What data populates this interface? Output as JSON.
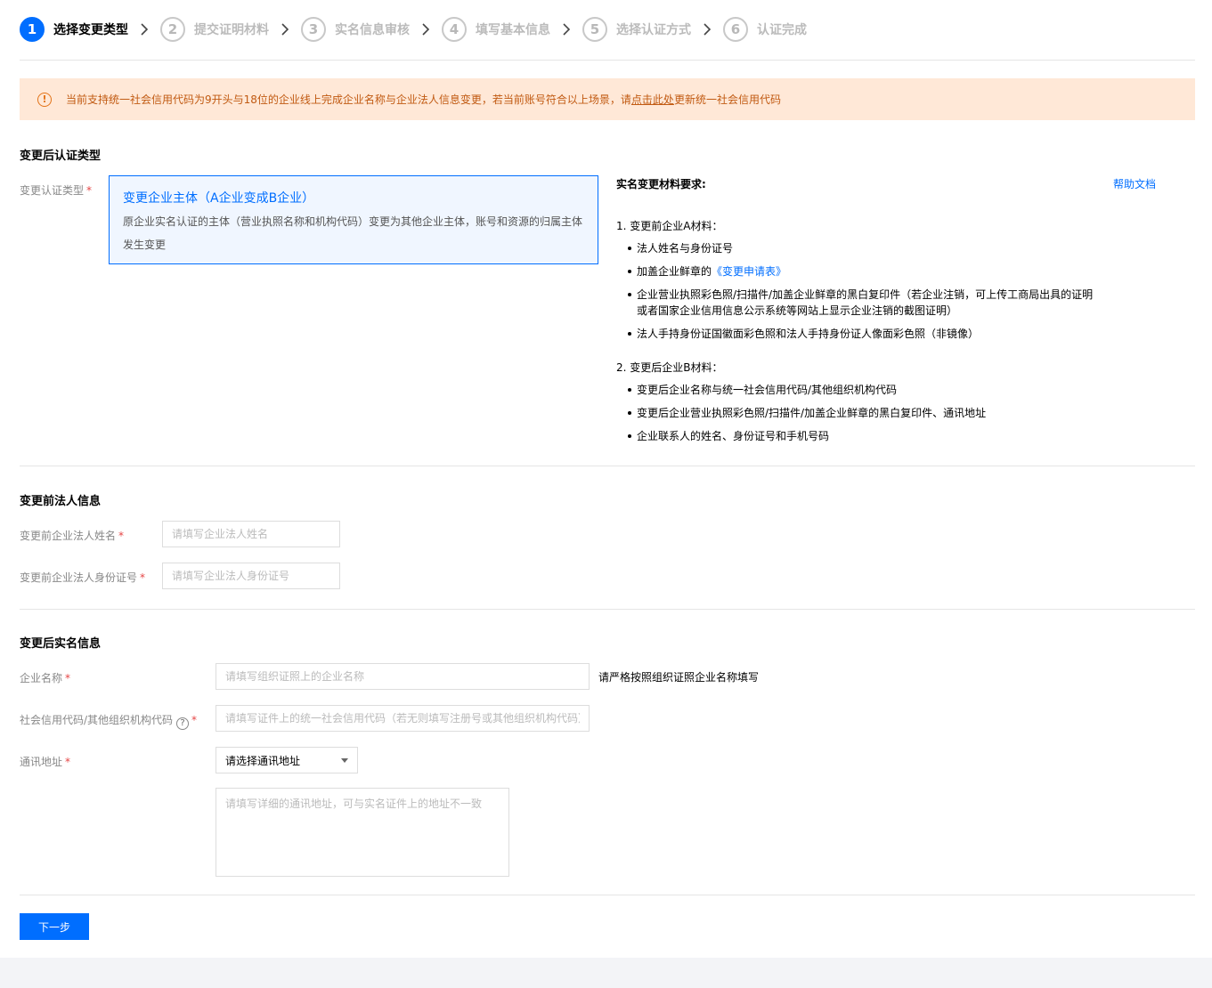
{
  "steps": [
    {
      "num": "1",
      "label": "选择变更类型"
    },
    {
      "num": "2",
      "label": "提交证明材料"
    },
    {
      "num": "3",
      "label": "实名信息审核"
    },
    {
      "num": "4",
      "label": "填写基本信息"
    },
    {
      "num": "5",
      "label": "选择认证方式"
    },
    {
      "num": "6",
      "label": "认证完成"
    }
  ],
  "alert": {
    "icon": "!",
    "text_before": "当前支持统一社会信用代码为9开头与18位的企业线上完成企业名称与企业法人信息变更，若当前账号符合以上场景，请",
    "link": "点击此处",
    "text_after": "更新统一社会信用代码"
  },
  "type_section": {
    "title": "变更后认证类型",
    "label": "变更认证类型",
    "req_mark": "*",
    "card_title": "变更企业主体（A企业变成B企业）",
    "card_desc": "原企业实名认证的主体（营业执照名称和机构代码）变更为其他企业主体，账号和资源的归属主体发生变更"
  },
  "requirements": {
    "heading": "实名变更材料要求:",
    "help_link": "帮助文档",
    "group_a_title": "1. 变更前企业A材料：",
    "group_a": {
      "item1": "法人姓名与身份证号",
      "item2_prefix": "加盖企业鲜章的",
      "item2_link": "《变更申请表》",
      "item3": "企业营业执照彩色照/扫描件/加盖企业鲜章的黑白复印件（若企业注销，可上传工商局出具的证明或者国家企业信用信息公示系统等网站上显示企业注销的截图证明）",
      "item4": "法人手持身份证国徽面彩色照和法人手持身份证人像面彩色照（非镜像）"
    },
    "group_b_title": "2. 变更后企业B材料：",
    "group_b": {
      "item1": "变更后企业名称与统一社会信用代码/其他组织机构代码",
      "item2": "变更后企业营业执照彩色照/扫描件/加盖企业鲜章的黑白复印件、通讯地址",
      "item3": "企业联系人的姓名、身份证号和手机号码"
    }
  },
  "legal_section": {
    "title": "变更前法人信息",
    "name_label": "变更前企业法人姓名",
    "name_placeholder": "请填写企业法人姓名",
    "id_label": "变更前企业法人身份证号",
    "id_placeholder": "请填写企业法人身份证号"
  },
  "after_section": {
    "title": "变更后实名信息",
    "company_label": "企业名称",
    "company_placeholder": "请填写组织证照上的企业名称",
    "company_note": "请严格按照组织证照企业名称填写",
    "credit_label": "社会信用代码/其他组织机构代码",
    "credit_help_icon": "?",
    "credit_placeholder": "请填写证件上的统一社会信用代码（若无则填写注册号或其他组织机构代码）",
    "address_label": "通讯地址",
    "address_select": "请选择通讯地址",
    "address_placeholder": "请填写详细的通讯地址，可与实名证件上的地址不一致"
  },
  "next_button": "下一步"
}
